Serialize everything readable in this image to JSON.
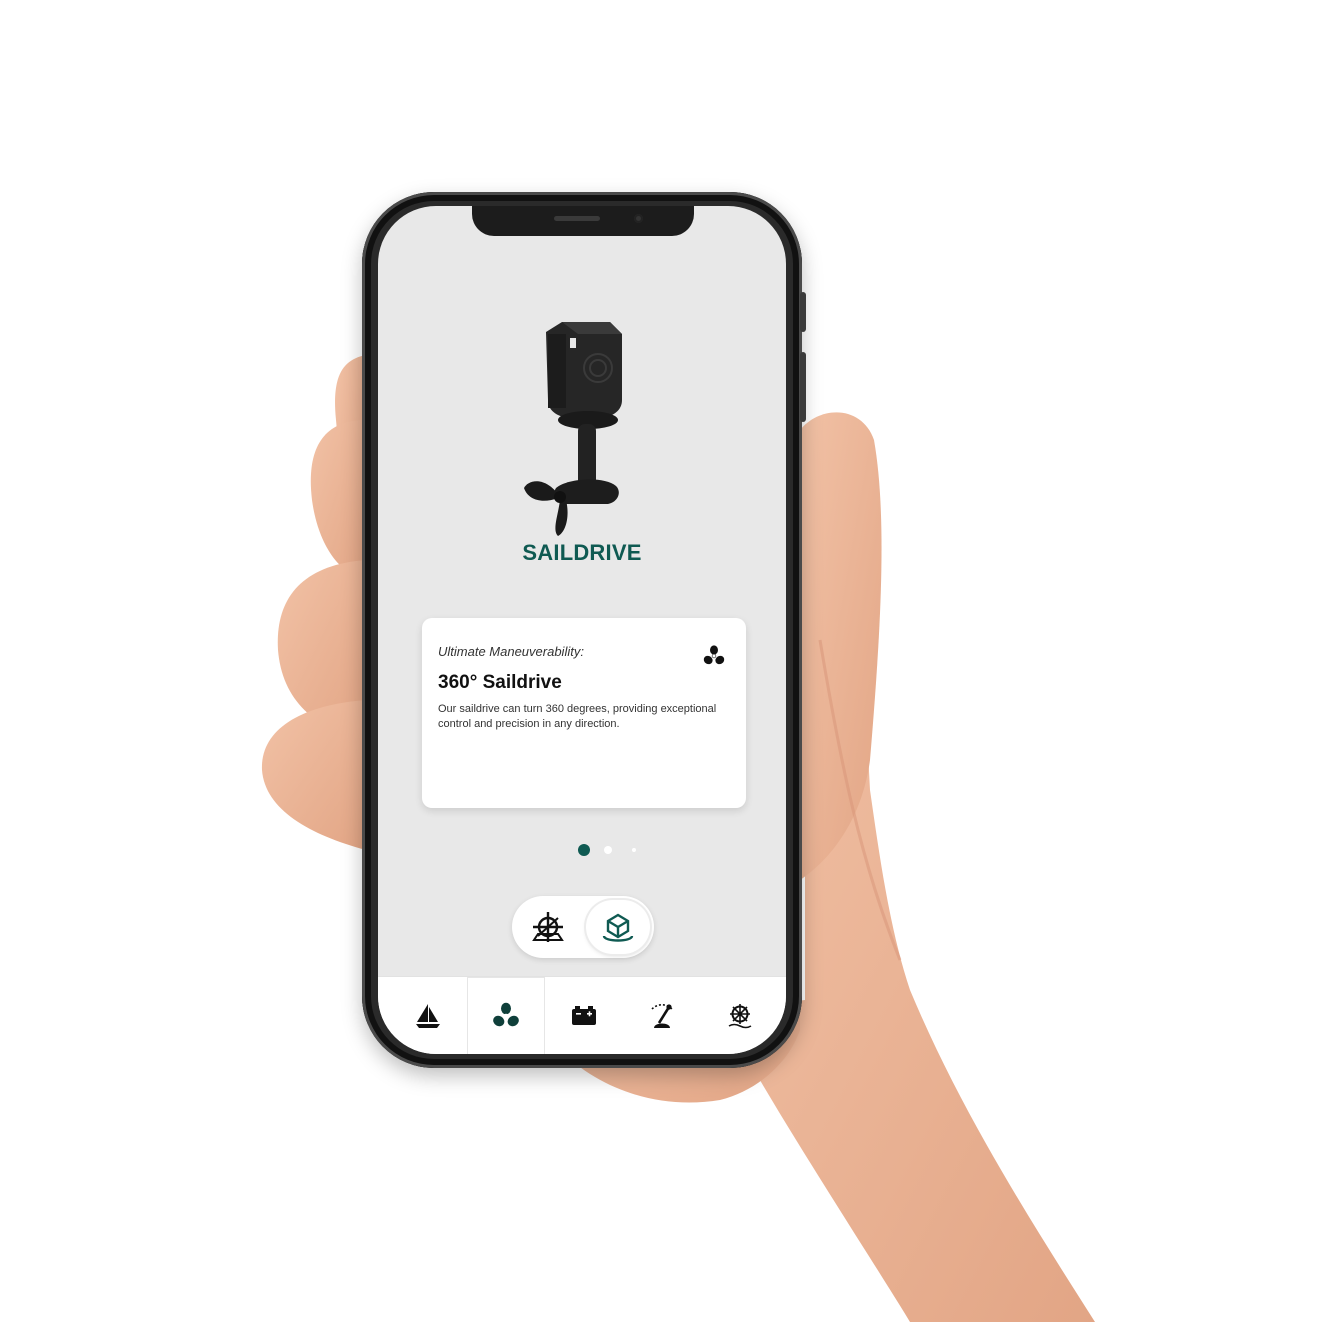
{
  "product": {
    "name": "SAILDRIVE",
    "image_icon": "saildrive-motor-image"
  },
  "card": {
    "subtitle": "Ultimate Maneuverability:",
    "title": "360° Saildrive",
    "description": "Our saildrive can turn 360 degrees, providing exceptional control and precision in any direction.",
    "icon": "propeller-icon"
  },
  "pager": {
    "count": 3,
    "active_index": 0
  },
  "view_toggle": {
    "options": [
      {
        "icon": "helm-3d-icon",
        "selected": false
      },
      {
        "icon": "box-3d-icon",
        "selected": true
      }
    ]
  },
  "bottom_nav": {
    "items": [
      {
        "icon": "sailboat-icon",
        "active": false
      },
      {
        "icon": "propeller-icon",
        "active": true
      },
      {
        "icon": "battery-icon",
        "active": false
      },
      {
        "icon": "throttle-icon",
        "active": false
      },
      {
        "icon": "ship-wheel-icon",
        "active": false
      }
    ]
  },
  "colors": {
    "accent": "#0f5a52",
    "screen_bg": "#e8e8e8",
    "card_bg": "#ffffff",
    "icon_dark": "#111111"
  }
}
